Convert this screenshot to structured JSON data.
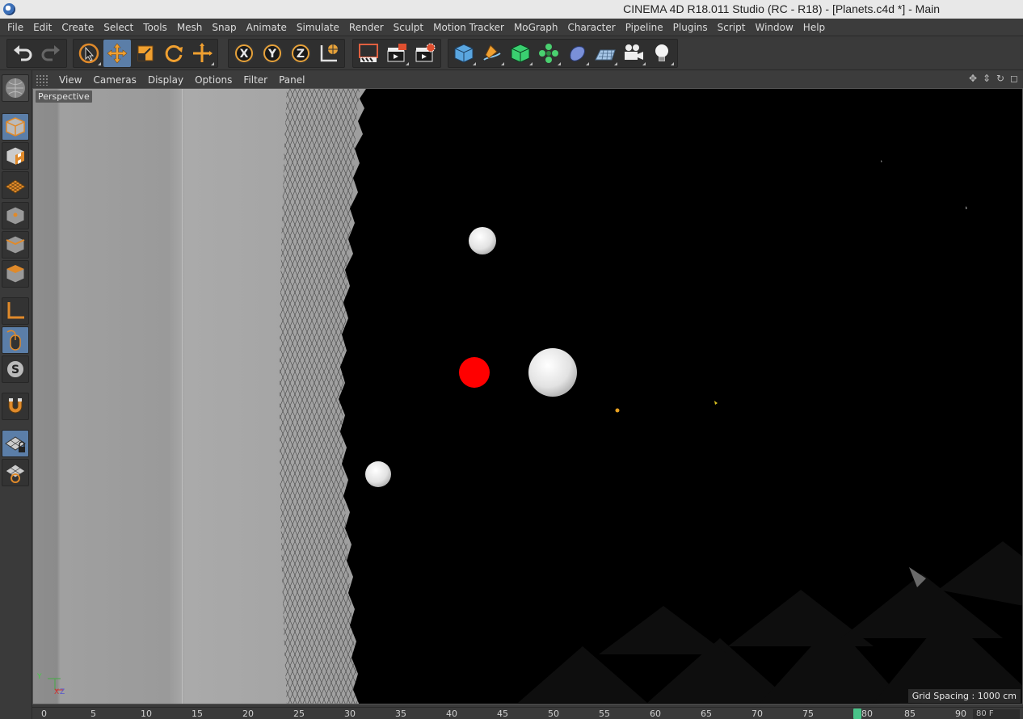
{
  "window": {
    "title": "CINEMA 4D R18.011 Studio (RC - R18) - [Planets.c4d *] - Main"
  },
  "menubar": {
    "items": [
      "File",
      "Edit",
      "Create",
      "Select",
      "Tools",
      "Mesh",
      "Snap",
      "Animate",
      "Simulate",
      "Render",
      "Sculpt",
      "Motion Tracker",
      "MoGraph",
      "Character",
      "Pipeline",
      "Plugins",
      "Script",
      "Window",
      "Help"
    ]
  },
  "toolbar": {
    "tools": [
      "undo-icon",
      "redo-icon",
      "live-selection-icon",
      "move-icon",
      "scale-icon",
      "rotate-icon",
      "recent-tool-icon",
      "x-axis-icon",
      "y-axis-icon",
      "z-axis-icon",
      "coordinate-system-icon",
      "render-region-icon",
      "render-view-icon",
      "render-settings-icon",
      "cube-icon",
      "pen-icon",
      "subdivision-icon",
      "cloner-icon",
      "deformer-icon",
      "floor-icon",
      "camera-icon",
      "light-icon"
    ]
  },
  "viewport": {
    "menu": [
      "View",
      "Cameras",
      "Display",
      "Options",
      "Filter",
      "Panel"
    ],
    "camera_label": "Perspective",
    "grid_spacing": "Grid Spacing : 1000 cm",
    "axis_y": "Y",
    "axis_z": "Z",
    "axis_x": "X",
    "colors": {
      "red_planet": "#ff0000",
      "white_planet": "#f2f2f2",
      "small_dot": "#e8a020"
    }
  },
  "timeline": {
    "ticks": [
      "0",
      "5",
      "10",
      "15",
      "20",
      "25",
      "30",
      "35",
      "40",
      "45",
      "50",
      "55",
      "60",
      "65",
      "70",
      "75",
      "80",
      "85",
      "90"
    ],
    "current_frame": "80",
    "end_field": "80 F"
  }
}
